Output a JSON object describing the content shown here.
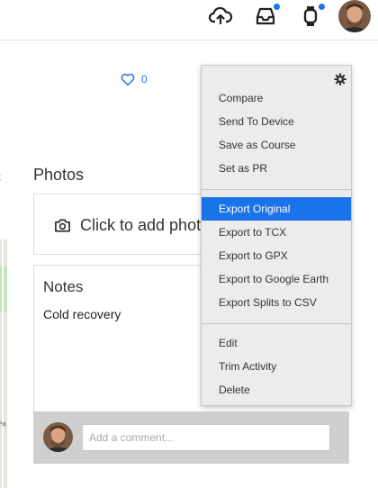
{
  "header": {
    "icons": [
      "upload-cloud-icon",
      "inbox-icon",
      "watch-icon"
    ],
    "accent_color": "#1a73e8"
  },
  "activity": {
    "like_count": "0",
    "photos": {
      "title": "Photos",
      "add_label": "Click to add photo"
    },
    "notes": {
      "title": "Notes",
      "text": "Cold recovery"
    },
    "comment": {
      "placeholder": "Add a comment..."
    }
  },
  "map": {
    "label": "Pa"
  },
  "menu": {
    "groups": [
      {
        "items": [
          "Compare",
          "Send To Device",
          "Save as Course",
          "Set as PR"
        ]
      },
      {
        "items": [
          "Export Original",
          "Export to TCX",
          "Export to GPX",
          "Export to Google Earth",
          "Export Splits to CSV"
        ]
      },
      {
        "items": [
          "Edit",
          "Trim Activity",
          "Delete"
        ]
      }
    ],
    "selected": "Export Original"
  }
}
